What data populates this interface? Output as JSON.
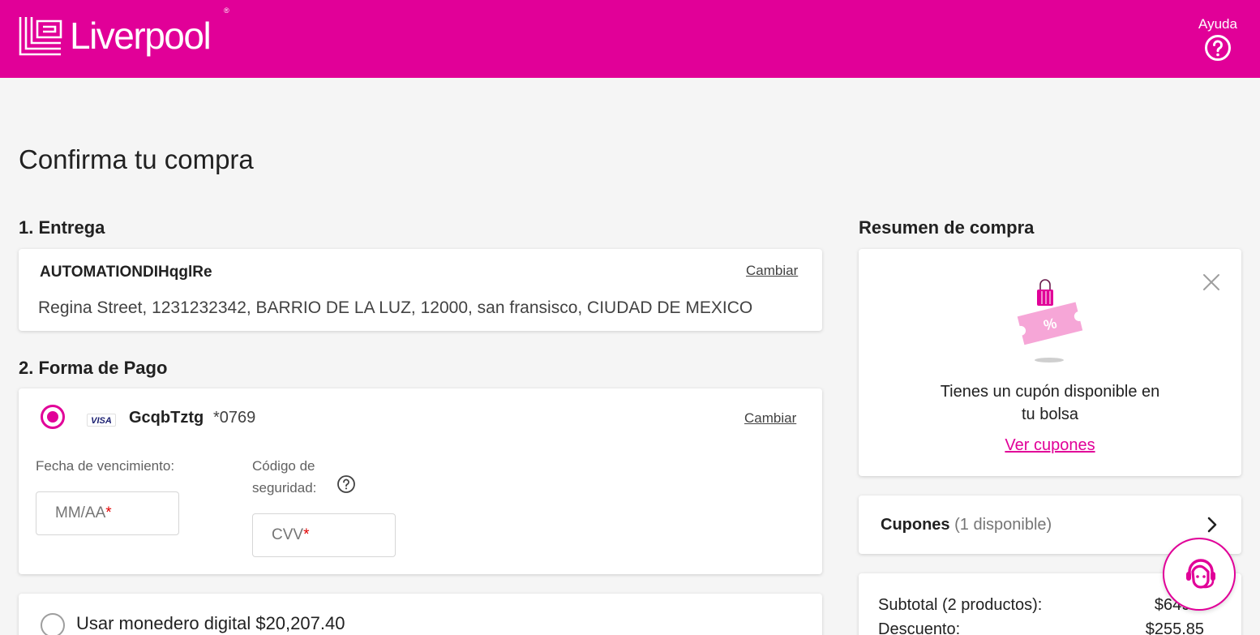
{
  "header": {
    "brand": "Liverpool",
    "registered_mark": "®",
    "help_label": "Ayuda",
    "brand_color": "#e10098"
  },
  "page": {
    "title": "Confirma tu compra"
  },
  "delivery": {
    "section_title": "1. Entrega",
    "recipient": "AUTOMATIONDIHqglRe",
    "change_label": "Cambiar",
    "address": "Regina Street, 1231232342, BARRIO DE LA LUZ, 12000, san fransisco, CIUDAD DE MEXICO"
  },
  "payment": {
    "section_title": "2. Forma de Pago",
    "card_brand": "VISA",
    "card_holder": "GcqbTztg",
    "card_last_digits": "*0769",
    "change_label": "Cambiar",
    "expiry_label": "Fecha de vencimiento:",
    "expiry_placeholder": "MM/AA",
    "security_label_line1": "Código de",
    "security_label_line2": "seguridad:",
    "cvv_placeholder": "CVV",
    "required_mark": "*",
    "wallet_label": "Usar monedero digital $20,207.40"
  },
  "summary": {
    "section_title": "Resumen de compra",
    "coupon_banner": {
      "text_line1": "Tienes un cupón disponible en",
      "text_line2": "tu bolsa",
      "link": "Ver cupones",
      "icon": "coupon-bag-icon"
    },
    "coupons_row": {
      "label": "Cupones",
      "count_text": "(1 disponible)"
    },
    "totals": [
      {
        "label": "Subtotal (2 productos):",
        "value": "$649.0"
      },
      {
        "label": "Descuento:",
        "value": "$255.85"
      }
    ]
  },
  "chat": {
    "icon": "support-agent-icon"
  }
}
